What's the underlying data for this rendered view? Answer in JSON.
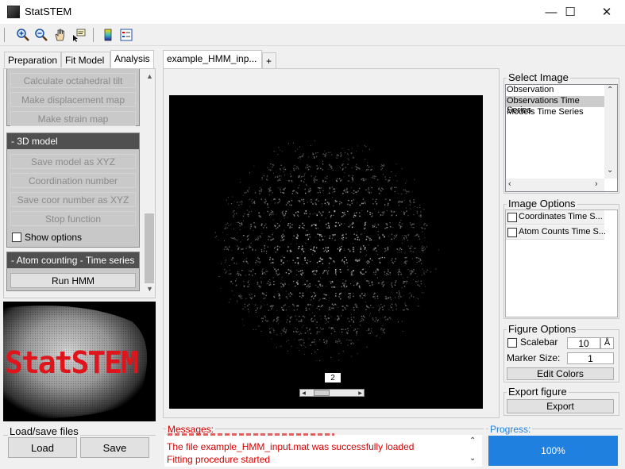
{
  "window": {
    "title": "StatSTEM",
    "minimize": "—",
    "maximize": "☐",
    "close": "✕"
  },
  "toolbar": {
    "icons": [
      "zoom-in-icon",
      "zoom-out-icon",
      "pan-hand-icon",
      "data-cursor-icon",
      "colorbar-icon",
      "legend-icon"
    ]
  },
  "left_tabs": [
    {
      "label": "Preparation"
    },
    {
      "label": "Fit Model"
    },
    {
      "label": "Analysis"
    }
  ],
  "analysis": {
    "top_buttons": [
      "Calculate octahedral tilt",
      "Make displacement map",
      "Make strain map"
    ],
    "model3d": {
      "header": "- 3D model",
      "buttons": [
        "Save model as XYZ",
        "Coordination number",
        "Save coor number as XYZ",
        "Stop function"
      ],
      "show_options": "Show options"
    },
    "atom_counting": {
      "header": "- Atom counting - Time series",
      "run_button": "Run HMM"
    }
  },
  "logo": {
    "text": "StatSTEM"
  },
  "load_save": {
    "title": "Load/save files",
    "load": "Load",
    "save": "Save"
  },
  "image_tabs": [
    {
      "label": "example_HMM_inp..."
    },
    {
      "label": "+"
    }
  ],
  "viewer": {
    "frame_number": "2"
  },
  "select_image": {
    "title": "Select Image",
    "items": [
      "Observation",
      "Observations Time Series",
      "Models Time Series"
    ],
    "selected_index": 1
  },
  "image_options": {
    "title": "Image Options",
    "items": [
      "Coordinates Time S...",
      "Atom Counts Time S..."
    ]
  },
  "figure_options": {
    "title": "Figure Options",
    "scalebar_label": "Scalebar",
    "scalebar_value": "10",
    "scalebar_unit": "Å",
    "marker_label": "Marker Size:",
    "marker_value": "1",
    "edit_colors": "Edit Colors"
  },
  "export_figure": {
    "title": "Export figure",
    "button": "Export"
  },
  "messages": {
    "title": "Messages:",
    "lines": [
      "The file example_HMM_input.mat was successfully loaded",
      "Fitting procedure started"
    ]
  },
  "progress": {
    "title": "Progress:",
    "value_text": "100%",
    "value": 1.0
  },
  "colors": {
    "accent_red": "#d40000",
    "progress_blue": "#1f80e0",
    "group_header": "#505050",
    "selected_item": "#cccccc"
  }
}
